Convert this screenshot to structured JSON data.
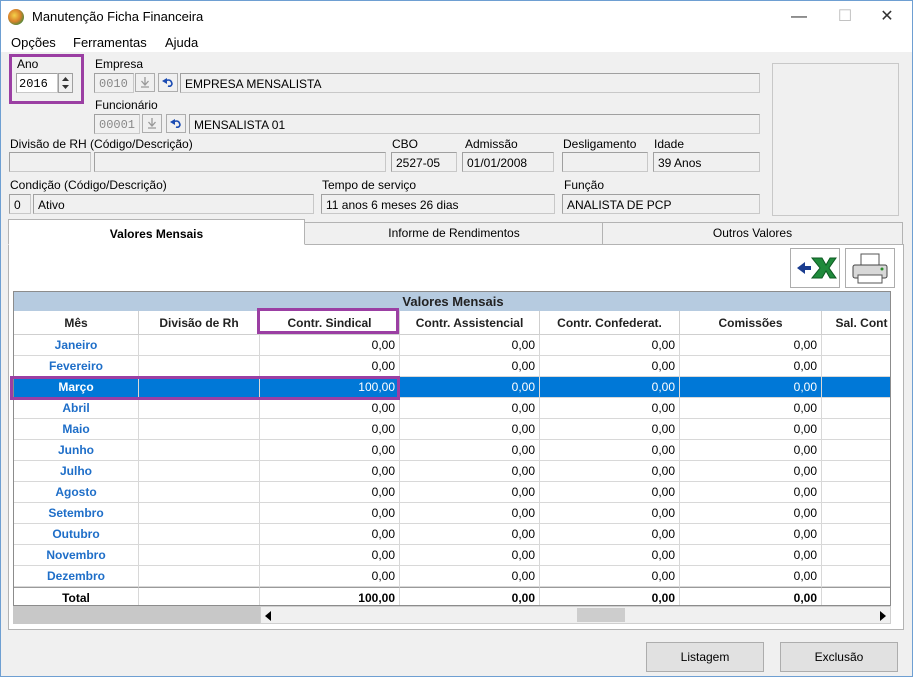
{
  "window": {
    "title": "Manutenção Ficha Financeira",
    "minimize_glyph": "—",
    "maximize_glyph": "☐",
    "close_glyph": "✕"
  },
  "menu": [
    "Opções",
    "Ferramentas",
    "Ajuda"
  ],
  "ano": {
    "label": "Ano",
    "value": "2016"
  },
  "empresa": {
    "label": "Empresa",
    "code": "0010",
    "name": "EMPRESA MENSALISTA"
  },
  "funcionario": {
    "label": "Funcionário",
    "code": "00001",
    "name": "MENSALISTA 01"
  },
  "divisao": {
    "label": "Divisão de RH (Código/Descrição)",
    "code": "",
    "desc": ""
  },
  "cbo": {
    "label": "CBO",
    "value": "2527-05"
  },
  "admissao": {
    "label": "Admissão",
    "value": "01/01/2008"
  },
  "desligamento": {
    "label": "Desligamento",
    "value": ""
  },
  "idade": {
    "label": "Idade",
    "value": "39 Anos"
  },
  "condicao": {
    "label": "Condição (Código/Descrição)",
    "code": "0",
    "desc": "Ativo"
  },
  "tempo_servico": {
    "label": "Tempo de serviço",
    "value": "11 anos 6 meses 26 dias"
  },
  "funcao": {
    "label": "Função",
    "value": "ANALISTA DE PCP"
  },
  "tabs": [
    "Valores Mensais",
    "Informe de Rendimentos",
    "Outros Valores"
  ],
  "grid": {
    "title": "Valores Mensais",
    "columns": [
      "Mês",
      "Divisão de Rh",
      "Contr. Sindical",
      "Contr. Assistencial",
      "Contr. Confederat.",
      "Comissões",
      "Sal. Cont"
    ],
    "rows": [
      {
        "mes": "Janeiro",
        "div": "",
        "v": [
          "0,00",
          "0,00",
          "0,00",
          "0,00"
        ]
      },
      {
        "mes": "Fevereiro",
        "div": "",
        "v": [
          "0,00",
          "0,00",
          "0,00",
          "0,00"
        ]
      },
      {
        "mes": "Março",
        "div": "",
        "v": [
          "100,00",
          "0,00",
          "0,00",
          "0,00"
        ]
      },
      {
        "mes": "Abril",
        "div": "",
        "v": [
          "0,00",
          "0,00",
          "0,00",
          "0,00"
        ]
      },
      {
        "mes": "Maio",
        "div": "",
        "v": [
          "0,00",
          "0,00",
          "0,00",
          "0,00"
        ]
      },
      {
        "mes": "Junho",
        "div": "",
        "v": [
          "0,00",
          "0,00",
          "0,00",
          "0,00"
        ]
      },
      {
        "mes": "Julho",
        "div": "",
        "v": [
          "0,00",
          "0,00",
          "0,00",
          "0,00"
        ]
      },
      {
        "mes": "Agosto",
        "div": "",
        "v": [
          "0,00",
          "0,00",
          "0,00",
          "0,00"
        ]
      },
      {
        "mes": "Setembro",
        "div": "",
        "v": [
          "0,00",
          "0,00",
          "0,00",
          "0,00"
        ]
      },
      {
        "mes": "Outubro",
        "div": "",
        "v": [
          "0,00",
          "0,00",
          "0,00",
          "0,00"
        ]
      },
      {
        "mes": "Novembro",
        "div": "",
        "v": [
          "0,00",
          "0,00",
          "0,00",
          "0,00"
        ]
      },
      {
        "mes": "Dezembro",
        "div": "",
        "v": [
          "0,00",
          "0,00",
          "0,00",
          "0,00"
        ]
      }
    ],
    "total": {
      "label": "Total",
      "v": [
        "100,00",
        "0,00",
        "0,00",
        "0,00"
      ]
    },
    "selected_row": "Março"
  },
  "buttons": {
    "listagem": "Listagem",
    "exclusao": "Exclusão"
  },
  "colors": {
    "selection": "#0078d7",
    "month_text": "#1e6ec8",
    "highlight": "#9b3fa3",
    "grid_title_bg": "#b6cbe0"
  },
  "icons": {
    "export": "excel-export-icon",
    "print": "printer-icon",
    "undo": "undo-arrow-icon",
    "lookup": "download-arrow-icon"
  }
}
